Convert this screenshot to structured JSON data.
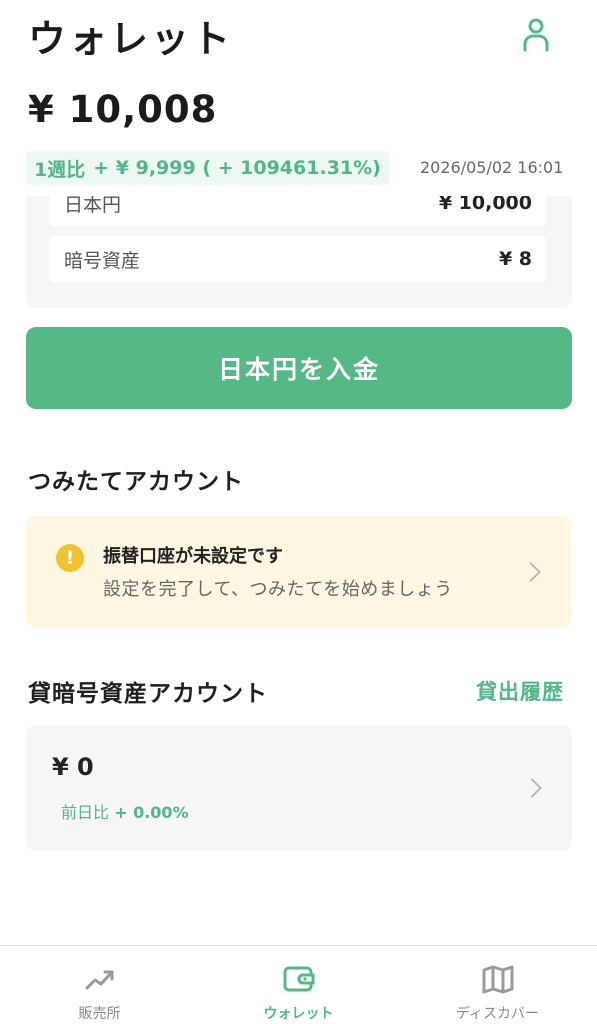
{
  "header": {
    "title": "ウォレット",
    "profile_icon": "user-icon"
  },
  "balance": "¥ 10,008",
  "weekly": {
    "label": "1週比",
    "change": "+ ¥ 9,999 ( + 109461.31%)",
    "timestamp": "2026/05/02 16:01"
  },
  "summary": {
    "rows": [
      {
        "label": "日本円",
        "value": "¥ 10,000"
      },
      {
        "label": "暗号資産",
        "value": "¥ 8"
      }
    ]
  },
  "deposit_button": "日本円を入金",
  "tsumitate": {
    "title": "つみたてアカウント",
    "notice_title": "振替口座が未設定です",
    "notice_sub": "設定を完了して、つみたてを始めましょう",
    "warning_icon": "!"
  },
  "lending": {
    "title": "貸暗号資産アカウント",
    "history_link": "貸出履歴",
    "balance": "¥ 0",
    "change_label": "前日比",
    "change_value": "+ 0.00%"
  },
  "nav": {
    "items": [
      {
        "label": "販売所",
        "icon": "trend-icon",
        "active": false
      },
      {
        "label": "ウォレット",
        "icon": "wallet-icon",
        "active": true
      },
      {
        "label": "ディスカバー",
        "icon": "map-icon",
        "active": false
      }
    ]
  },
  "colors": {
    "accent": "#55b887",
    "notice_bg": "#fdf7e2",
    "warning": "#f1c232"
  }
}
